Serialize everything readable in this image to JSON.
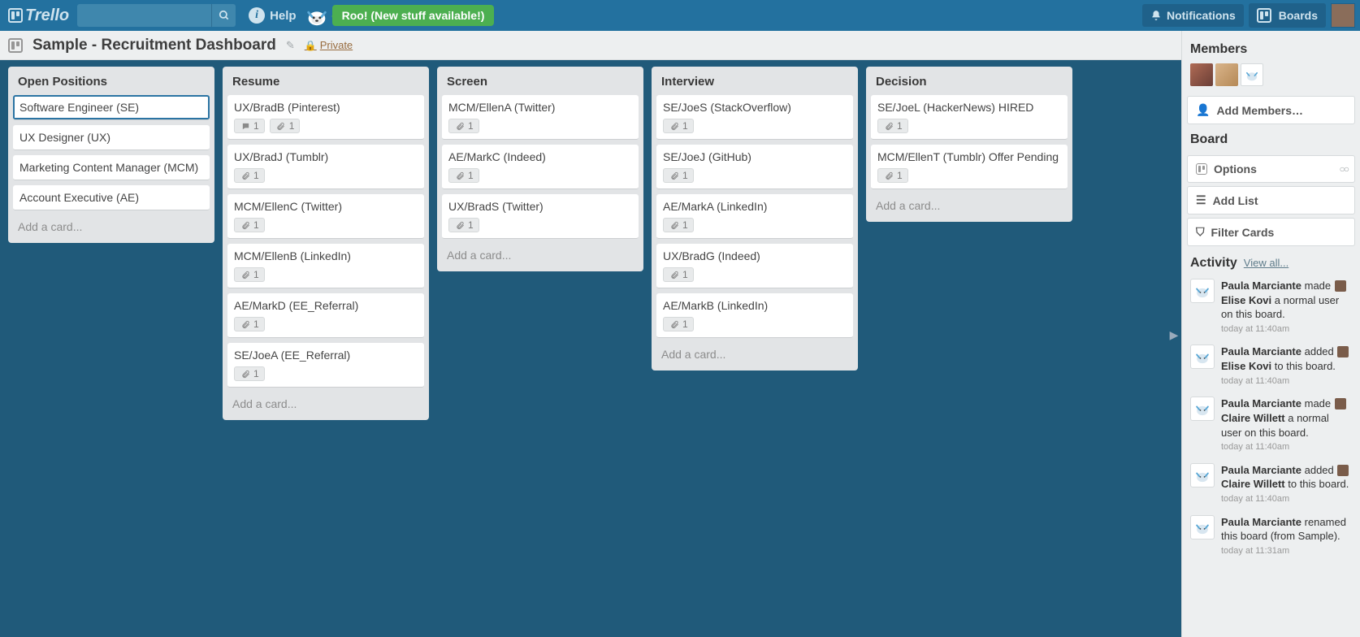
{
  "logo_text": "Trello",
  "help_label": "Help",
  "roo_label": "Roo! (New stuff available!)",
  "notifications_label": "Notifications",
  "boards_label": "Boards",
  "board_title": "Sample - Recruitment Dashboard",
  "private_label": "Private",
  "add_card_label": "Add a card...",
  "lists": [
    {
      "title": "Open Positions",
      "cards": [
        {
          "title": "Software Engineer (SE)",
          "selected": true
        },
        {
          "title": "UX Designer (UX)"
        },
        {
          "title": "Marketing Content Manager (MCM)"
        },
        {
          "title": "Account Executive (AE)"
        }
      ]
    },
    {
      "title": "Resume",
      "cards": [
        {
          "title": "UX/BradB (Pinterest)",
          "comments": 1,
          "attach": 1
        },
        {
          "title": "UX/BradJ (Tumblr)",
          "attach": 1
        },
        {
          "title": "MCM/EllenC (Twitter)",
          "attach": 1
        },
        {
          "title": "MCM/EllenB (LinkedIn)",
          "attach": 1
        },
        {
          "title": "AE/MarkD (EE_Referral)",
          "attach": 1
        },
        {
          "title": "SE/JoeA (EE_Referral)",
          "attach": 1
        }
      ]
    },
    {
      "title": "Screen",
      "cards": [
        {
          "title": "MCM/EllenA (Twitter)",
          "attach": 1
        },
        {
          "title": "AE/MarkC (Indeed)",
          "attach": 1
        },
        {
          "title": "UX/BradS (Twitter)",
          "attach": 1
        }
      ]
    },
    {
      "title": "Interview",
      "cards": [
        {
          "title": "SE/JoeS (StackOverflow)",
          "attach": 1
        },
        {
          "title": "SE/JoeJ (GitHub)",
          "attach": 1
        },
        {
          "title": "AE/MarkA (LinkedIn)",
          "attach": 1
        },
        {
          "title": "UX/BradG (Indeed)",
          "attach": 1
        },
        {
          "title": "AE/MarkB (LinkedIn)",
          "attach": 1
        }
      ]
    },
    {
      "title": "Decision",
      "cards": [
        {
          "title": "SE/JoeL (HackerNews) HIRED",
          "attach": 1
        },
        {
          "title": "MCM/EllenT (Tumblr) Offer Pending",
          "attach": 1
        }
      ]
    }
  ],
  "sidebar": {
    "members_label": "Members",
    "add_members_label": "Add Members…",
    "board_label": "Board",
    "options_label": "Options",
    "add_list_label": "Add List",
    "filter_label": "Filter Cards",
    "activity_label": "Activity",
    "view_all_label": "View all..."
  },
  "activity": [
    {
      "actor": "Paula Marciante",
      "verb": "made",
      "target": "Elise Kovi",
      "suffix": "a normal user on this board.",
      "time": "today at 11:40am",
      "avatar": true
    },
    {
      "actor": "Paula Marciante",
      "verb": "added",
      "target": "Elise Kovi",
      "suffix": "to this board.",
      "time": "today at 11:40am",
      "avatar": true
    },
    {
      "actor": "Paula Marciante",
      "verb": "made",
      "target": "Claire Willett",
      "suffix": "a normal user on this board.",
      "time": "today at 11:40am",
      "avatar": true
    },
    {
      "actor": "Paula Marciante",
      "verb": "added",
      "target": "Claire Willett",
      "suffix": "to this board.",
      "time": "today at 11:40am",
      "avatar": true
    },
    {
      "actor": "Paula Marciante",
      "verb": "renamed this board (from Sample).",
      "target": "",
      "suffix": "",
      "time": "today at 11:31am",
      "avatar": false
    }
  ]
}
